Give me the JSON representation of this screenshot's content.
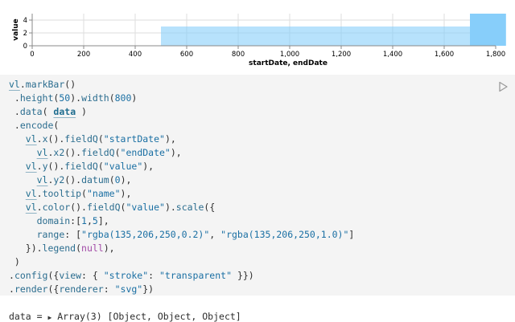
{
  "chart_data": {
    "type": "bar",
    "mark": "ranged-bar",
    "xlabel": "startDate, endDate",
    "ylabel": "value",
    "xlim": [
      0,
      1800
    ],
    "ylim": [
      0,
      5
    ],
    "x_ticks": [
      0,
      200,
      400,
      600,
      800,
      1000,
      1200,
      1400,
      1600,
      1800
    ],
    "x_tick_labels": [
      "0",
      "200",
      "400",
      "600",
      "800",
      "1,000",
      "1,200",
      "1,400",
      "1,600",
      "1,800"
    ],
    "y_ticks": [
      0,
      2,
      4
    ],
    "grid": true,
    "color_domain": [
      1,
      5
    ],
    "color_range": [
      "rgba(135,206,250,0.2)",
      "rgba(135,206,250,1.0)"
    ],
    "bars": [
      {
        "startDate": 500,
        "endDate": 1700,
        "value": 3
      },
      {
        "startDate": 1700,
        "endDate": 1840,
        "value": 5
      }
    ]
  },
  "code": {
    "lines": [
      [
        [
          "var",
          "vl"
        ],
        [
          "plain",
          "."
        ],
        [
          "meth",
          "markBar"
        ],
        [
          "plain",
          "()"
        ]
      ],
      [
        [
          "plain",
          " ."
        ],
        [
          "meth",
          "height"
        ],
        [
          "plain",
          "("
        ],
        [
          "num",
          "50"
        ],
        [
          "plain",
          ")."
        ],
        [
          "meth",
          "width"
        ],
        [
          "plain",
          "("
        ],
        [
          "num",
          "800"
        ],
        [
          "plain",
          ")"
        ]
      ],
      [
        [
          "plain",
          " ."
        ],
        [
          "meth",
          "data"
        ],
        [
          "plain",
          "( "
        ],
        [
          "data",
          "data"
        ],
        [
          "plain",
          " )"
        ]
      ],
      [
        [
          "plain",
          " ."
        ],
        [
          "meth",
          "encode"
        ],
        [
          "plain",
          "("
        ]
      ],
      [
        [
          "plain",
          "   "
        ],
        [
          "var",
          "vl"
        ],
        [
          "plain",
          "."
        ],
        [
          "meth",
          "x"
        ],
        [
          "plain",
          "()."
        ],
        [
          "meth",
          "fieldQ"
        ],
        [
          "plain",
          "("
        ],
        [
          "str",
          "\"startDate\""
        ],
        [
          "plain",
          "),"
        ]
      ],
      [
        [
          "plain",
          "     "
        ],
        [
          "var",
          "vl"
        ],
        [
          "plain",
          "."
        ],
        [
          "meth",
          "x2"
        ],
        [
          "plain",
          "()."
        ],
        [
          "meth",
          "fieldQ"
        ],
        [
          "plain",
          "("
        ],
        [
          "str",
          "\"endDate\""
        ],
        [
          "plain",
          "),"
        ]
      ],
      [
        [
          "plain",
          "   "
        ],
        [
          "var",
          "vl"
        ],
        [
          "plain",
          "."
        ],
        [
          "meth",
          "y"
        ],
        [
          "plain",
          "()."
        ],
        [
          "meth",
          "fieldQ"
        ],
        [
          "plain",
          "("
        ],
        [
          "str",
          "\"value\""
        ],
        [
          "plain",
          "),"
        ]
      ],
      [
        [
          "plain",
          "     "
        ],
        [
          "var",
          "vl"
        ],
        [
          "plain",
          "."
        ],
        [
          "meth",
          "y2"
        ],
        [
          "plain",
          "()."
        ],
        [
          "meth",
          "datum"
        ],
        [
          "plain",
          "("
        ],
        [
          "num",
          "0"
        ],
        [
          "plain",
          "),"
        ]
      ],
      [
        [
          "plain",
          "   "
        ],
        [
          "var",
          "vl"
        ],
        [
          "plain",
          "."
        ],
        [
          "meth",
          "tooltip"
        ],
        [
          "plain",
          "("
        ],
        [
          "str",
          "\"name\""
        ],
        [
          "plain",
          "),"
        ]
      ],
      [
        [
          "plain",
          "   "
        ],
        [
          "var",
          "vl"
        ],
        [
          "plain",
          "."
        ],
        [
          "meth",
          "color"
        ],
        [
          "plain",
          "()."
        ],
        [
          "meth",
          "fieldQ"
        ],
        [
          "plain",
          "("
        ],
        [
          "str",
          "\"value\""
        ],
        [
          "plain",
          ")."
        ],
        [
          "meth",
          "scale"
        ],
        [
          "plain",
          "({"
        ]
      ],
      [
        [
          "plain",
          "     "
        ],
        [
          "prop",
          "domain"
        ],
        [
          "plain",
          ":["
        ],
        [
          "num",
          "1"
        ],
        [
          "plain",
          ","
        ],
        [
          "num",
          "5"
        ],
        [
          "plain",
          "],"
        ]
      ],
      [
        [
          "plain",
          "     "
        ],
        [
          "prop",
          "range"
        ],
        [
          "plain",
          ": ["
        ],
        [
          "str",
          "\"rgba(135,206,250,0.2)\""
        ],
        [
          "plain",
          ", "
        ],
        [
          "str",
          "\"rgba(135,206,250,1.0)\""
        ],
        [
          "plain",
          "]"
        ]
      ],
      [
        [
          "plain",
          "   })."
        ],
        [
          "meth",
          "legend"
        ],
        [
          "plain",
          "("
        ],
        [
          "kw",
          "null"
        ],
        [
          "plain",
          "),"
        ]
      ],
      [
        [
          "plain",
          " )"
        ]
      ],
      [
        [
          "plain",
          "."
        ],
        [
          "meth",
          "config"
        ],
        [
          "plain",
          "({"
        ],
        [
          "prop",
          "view"
        ],
        [
          "plain",
          ": { "
        ],
        [
          "str",
          "\"stroke\""
        ],
        [
          "plain",
          ": "
        ],
        [
          "str",
          "\"transparent\""
        ],
        [
          "plain",
          " }})"
        ]
      ],
      [
        [
          "plain",
          "."
        ],
        [
          "meth",
          "render"
        ],
        [
          "plain",
          "({"
        ],
        [
          "prop",
          "renderer"
        ],
        [
          "plain",
          ": "
        ],
        [
          "str",
          "\"svg\""
        ],
        [
          "plain",
          "})"
        ]
      ]
    ]
  },
  "output": {
    "name": "data",
    "equals": " = ",
    "toggle_icon": "triangle-right-icon",
    "summary": "Array(3) [Object, Object, Object]"
  },
  "run_icon": "play-icon"
}
